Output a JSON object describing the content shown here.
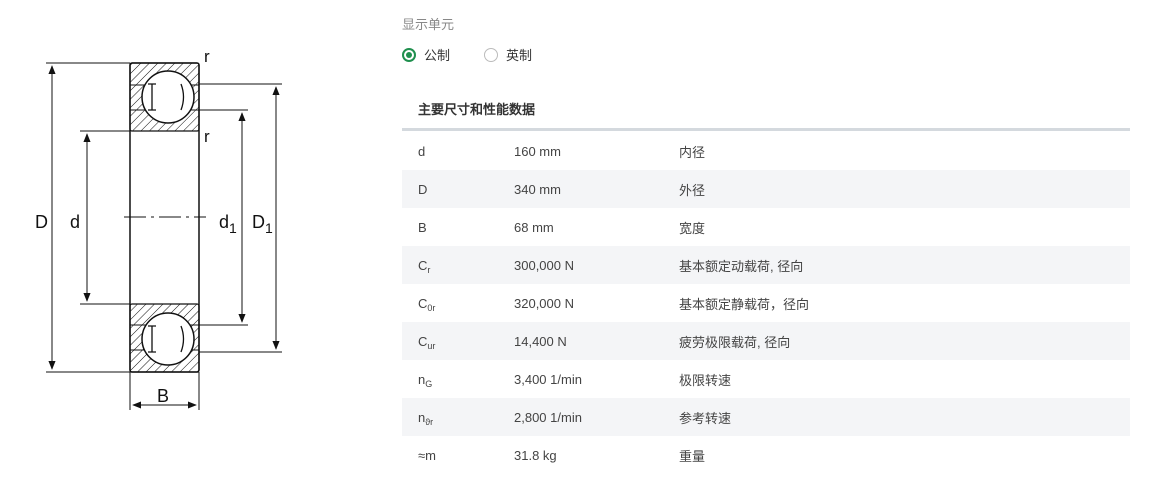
{
  "drawing": {
    "labels": {
      "r": "r",
      "D": "D",
      "d": "d",
      "d1_main": "d",
      "d1_sub": "1",
      "D1_main": "D",
      "D1_sub": "1",
      "B": "B"
    }
  },
  "units": {
    "label": "显示单元",
    "options": [
      {
        "label": "公制",
        "selected": true
      },
      {
        "label": "英制",
        "selected": false
      }
    ]
  },
  "table": {
    "title": "主要尺寸和性能数据",
    "rows": [
      {
        "symbol": "d",
        "sub": "",
        "value": "160 mm",
        "desc": "内径"
      },
      {
        "symbol": "D",
        "sub": "",
        "value": "340 mm",
        "desc": "外径"
      },
      {
        "symbol": "B",
        "sub": "",
        "value": "68 mm",
        "desc": "宽度"
      },
      {
        "symbol": "C",
        "sub": "r",
        "value": "300,000 N",
        "desc": "基本额定动载荷, 径向"
      },
      {
        "symbol": "C",
        "sub": "0r",
        "value": "320,000 N",
        "desc": "基本额定静载荷，径向"
      },
      {
        "symbol": "C",
        "sub": "ur",
        "value": "14,400 N",
        "desc": "疲劳极限载荷, 径向"
      },
      {
        "symbol": "n",
        "sub": "G",
        "value": "3,400 1/min",
        "desc": "极限转速"
      },
      {
        "symbol": "n",
        "sub": "ϑr",
        "value": "2,800 1/min",
        "desc": "参考转速"
      },
      {
        "symbol": "≈m",
        "sub": "",
        "value": "31.8 kg",
        "desc": "重量"
      }
    ]
  }
}
